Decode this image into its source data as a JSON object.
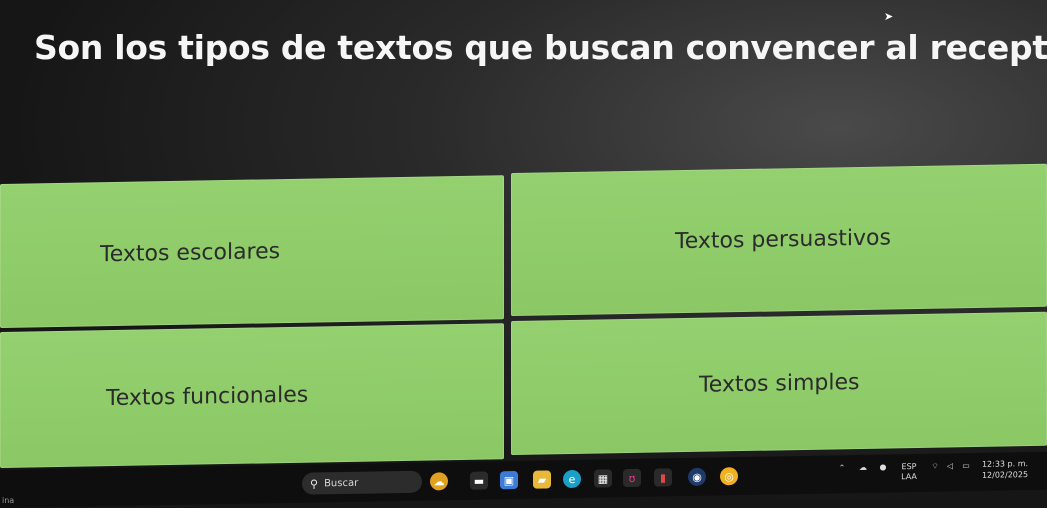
{
  "question": {
    "text": "Son los tipos de textos que buscan convencer al receptor."
  },
  "options": [
    {
      "label": "Textos escolares"
    },
    {
      "label": "Textos persuastivos"
    },
    {
      "label": "Textos funcionales"
    },
    {
      "label": "Textos simples"
    }
  ],
  "taskbar": {
    "search_label": "Buscar",
    "language_top": "ESP",
    "language_bottom": "LAA",
    "time": "12:33 p. m.",
    "date": "12/02/2025",
    "corner_text": "ina"
  },
  "colors": {
    "option_bg": "#8fcc6a",
    "background": "#1a1a1a",
    "question_text": "#f6f6f6"
  },
  "icons": [
    "windows-start-icon",
    "search-icon",
    "weather-icon",
    "taskview-icon",
    "files-icon",
    "folder-icon",
    "edge-icon",
    "store-icon",
    "xiaomi-icon",
    "app-icon",
    "steam-icon",
    "chrome-icon",
    "chevron-up-icon",
    "onedrive-icon",
    "wifi-icon",
    "volume-icon",
    "battery-icon"
  ]
}
